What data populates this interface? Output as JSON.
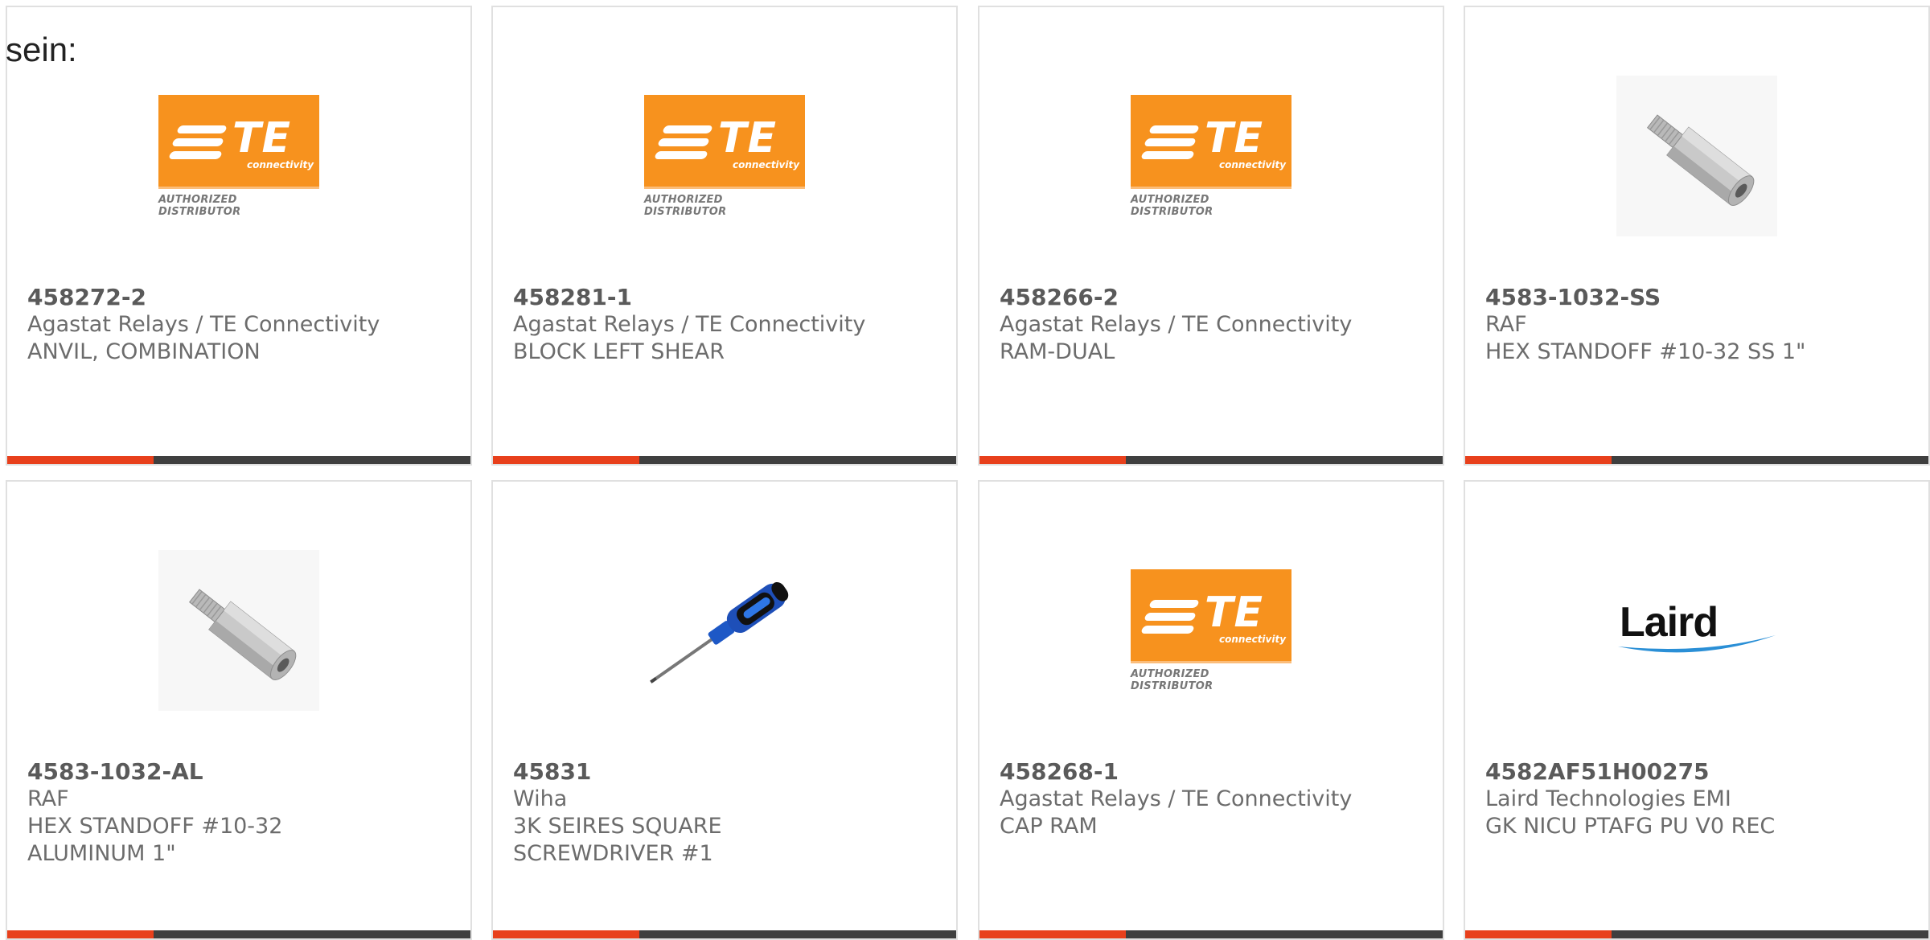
{
  "lead_text": "sein:",
  "colors": {
    "accent": "#e8401c",
    "bar": "#3f3f3f",
    "te_orange": "#f7921e"
  },
  "logos": {
    "te": {
      "word": "TE",
      "sub": "connectivity",
      "authorized": "AUTHORIZED DISTRIBUTOR"
    },
    "laird": {
      "word": "Laird"
    }
  },
  "products": [
    {
      "part_number": "458272-2",
      "manufacturer": "Agastat Relays / TE Connectivity",
      "description": "ANVIL, COMBINATION",
      "image": "te-logo"
    },
    {
      "part_number": "458281-1",
      "manufacturer": "Agastat Relays / TE Connectivity",
      "description": "BLOCK LEFT SHEAR",
      "image": "te-logo"
    },
    {
      "part_number": "458266-2",
      "manufacturer": "Agastat Relays / TE Connectivity",
      "description": "RAM-DUAL",
      "image": "te-logo"
    },
    {
      "part_number": "4583-1032-SS",
      "manufacturer": "RAF",
      "description": "HEX STANDOFF #10-32 SS 1\"",
      "image": "hex-standoff-photo"
    },
    {
      "part_number": "4583-1032-AL",
      "manufacturer": "RAF",
      "description": "HEX STANDOFF #10-32\nALUMINUM 1\"",
      "image": "hex-standoff-photo"
    },
    {
      "part_number": "45831",
      "manufacturer": "Wiha",
      "description": "3K SEIRES SQUARE\nSCREWDRIVER #1",
      "image": "screwdriver-photo"
    },
    {
      "part_number": "458268-1",
      "manufacturer": "Agastat Relays / TE Connectivity",
      "description": "CAP RAM",
      "image": "te-logo"
    },
    {
      "part_number": "4582AF51H00275",
      "manufacturer": "Laird Technologies EMI",
      "description": "GK NICU PTAFG PU V0 REC",
      "image": "laird-logo"
    }
  ]
}
